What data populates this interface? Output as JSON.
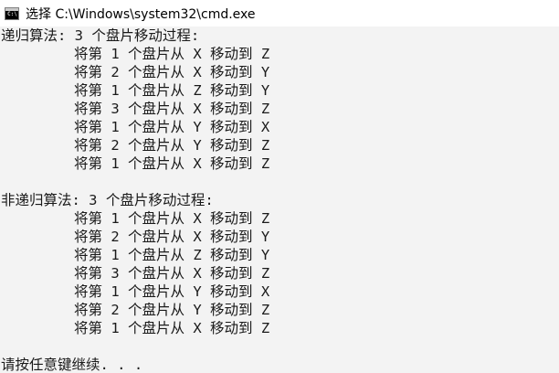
{
  "window": {
    "title": "选择 C:\\Windows\\system32\\cmd.exe",
    "icon": "cmd-icon"
  },
  "console": {
    "recursive_header": "递归算法: 3 个盘片移动过程:",
    "recursive_moves": [
      "将第 1 个盘片从 X 移动到 Z",
      "将第 2 个盘片从 X 移动到 Y",
      "将第 1 个盘片从 Z 移动到 Y",
      "将第 3 个盘片从 X 移动到 Z",
      "将第 1 个盘片从 Y 移动到 X",
      "将第 2 个盘片从 Y 移动到 Z",
      "将第 1 个盘片从 X 移动到 Z"
    ],
    "nonrecursive_header": "非递归算法: 3 个盘片移动过程:",
    "nonrecursive_moves": [
      "将第 1 个盘片从 X 移动到 Z",
      "将第 2 个盘片从 X 移动到 Y",
      "将第 1 个盘片从 Z 移动到 Y",
      "将第 3 个盘片从 X 移动到 Z",
      "将第 1 个盘片从 Y 移动到 X",
      "将第 2 个盘片从 Y 移动到 Z",
      "将第 1 个盘片从 X 移动到 Z"
    ],
    "prompt": "请按任意键继续. . ."
  }
}
